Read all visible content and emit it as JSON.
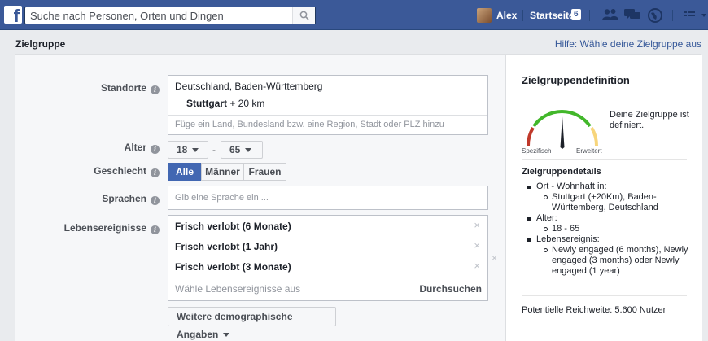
{
  "topbar": {
    "logo": "f",
    "search_placeholder": "Suche nach Personen, Orten und Dingen",
    "user_name": "Alex",
    "home_label": "Startseite",
    "home_badge": "6"
  },
  "page": {
    "title": "Zielgruppe",
    "help_link": "Hilfe: Wähle deine Zielgruppe aus"
  },
  "form": {
    "locations": {
      "label": "Standorte",
      "country": "Deutschland, Baden-Württemberg",
      "city": "Stuttgart",
      "radius": "+ 20 km",
      "placeholder": "Füge ein Land, Bundesland bzw. eine Region, Stadt oder PLZ hinzu"
    },
    "age": {
      "label": "Alter",
      "min": "18",
      "dash": "-",
      "max": "65"
    },
    "gender": {
      "label": "Geschlecht",
      "options": [
        "Alle",
        "Männer",
        "Frauen"
      ],
      "selected": "Alle"
    },
    "languages": {
      "label": "Sprachen",
      "placeholder": "Gib eine Sprache ein ..."
    },
    "life_events": {
      "label": "Lebensereignisse",
      "items": [
        "Frisch verlobt (6 Monate)",
        "Frisch verlobt (1 Jahr)",
        "Frisch verlobt (3 Monate)"
      ],
      "remove_glyph": "×",
      "placeholder": "Wähle Lebensereignisse aus",
      "browse_label": "Durchsuchen"
    },
    "more_button": "Weitere demographische Angaben"
  },
  "definition": {
    "title": "Zielgruppendefinition",
    "gauge_left": "Spezifisch",
    "gauge_right": "Erweitert",
    "status": "Deine Zielgruppe ist definiert.",
    "details_title": "Zielgruppendetails",
    "details": {
      "location_head": "Ort - Wohnhaft in:",
      "location_value": "Stuttgart (+20Km), Baden-Württemberg, Deutschland",
      "age_head": "Alter:",
      "age_value": "18 - 65",
      "event_head": "Lebensereignis:",
      "event_value": "Newly engaged (6 months), Newly engaged (3 months) oder Newly engaged (1 year)"
    },
    "reach": "Potentielle Reichweite: 5.600 Nutzer"
  },
  "colors": {
    "brand": "#3b5998",
    "accent": "#4267b2",
    "gauge_green": "#42b72a",
    "gauge_red": "#c0392b",
    "gauge_yellow": "#f7d57b"
  }
}
